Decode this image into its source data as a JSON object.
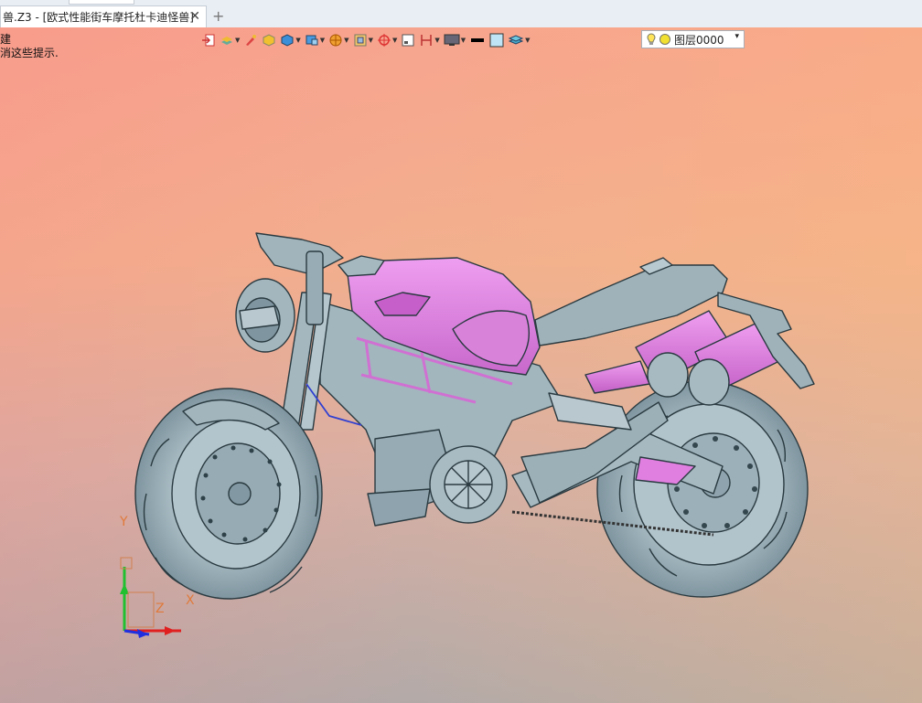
{
  "tab": {
    "title": "兽.Z3 - [欧式性能街车摩托杜卡迪怪兽]",
    "close_label": "✕",
    "new_label": "+"
  },
  "hint": {
    "line1": "建",
    "line2": "消这些提示."
  },
  "toolbar": {
    "icons": [
      "exit-icon",
      "layer-stack-icon",
      "brush-icon",
      "shaded-box-icon",
      "solid-cube-icon",
      "view-box-icon",
      "sphere-icon",
      "fit-view-icon",
      "target-icon",
      "frame-icon",
      "dimension-icon",
      "monitor-icon",
      "line-style-icon",
      "fill-color-icon",
      "layer-sheets-icon"
    ],
    "layer_value": "图层0000",
    "layer_dropdown": "▾"
  },
  "triad": {
    "x_label": "X",
    "y_label": "Y",
    "z_label": "Z"
  },
  "colors": {
    "body_gray": "#9fb3bc",
    "accent_pink": "#e07fe0",
    "outline": "#2a3a40",
    "x_axis": "#e02020",
    "y_axis": "#20c030",
    "z_axis": "#2030e0"
  }
}
